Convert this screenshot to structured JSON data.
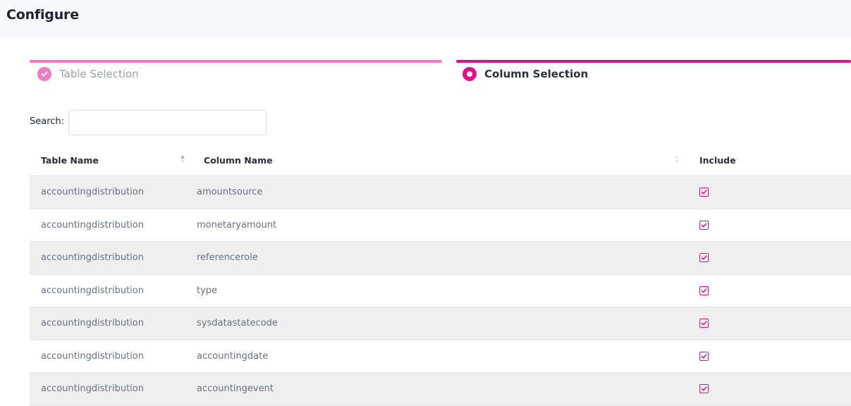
{
  "page": {
    "title": "Configure"
  },
  "stepper": {
    "steps": [
      {
        "label": "Table Selection",
        "state": "completed"
      },
      {
        "label": "Column Selection",
        "state": "active"
      }
    ],
    "colors": {
      "accent": "#e20e8b",
      "accent_light": "#f07ac4"
    }
  },
  "search": {
    "label": "Search:",
    "value": "",
    "placeholder": ""
  },
  "table": {
    "columns": [
      "Table Name",
      "Column Name",
      "Include"
    ],
    "rows": [
      {
        "table_name": "accountingdistribution",
        "column_name": "amountsource",
        "include": true
      },
      {
        "table_name": "accountingdistribution",
        "column_name": "monetaryamount",
        "include": true
      },
      {
        "table_name": "accountingdistribution",
        "column_name": "referencerole",
        "include": true
      },
      {
        "table_name": "accountingdistribution",
        "column_name": "type",
        "include": true
      },
      {
        "table_name": "accountingdistribution",
        "column_name": "sysdatastatecode",
        "include": true
      },
      {
        "table_name": "accountingdistribution",
        "column_name": "accountingdate",
        "include": true
      },
      {
        "table_name": "accountingdistribution",
        "column_name": "accountingevent",
        "include": true
      }
    ]
  }
}
